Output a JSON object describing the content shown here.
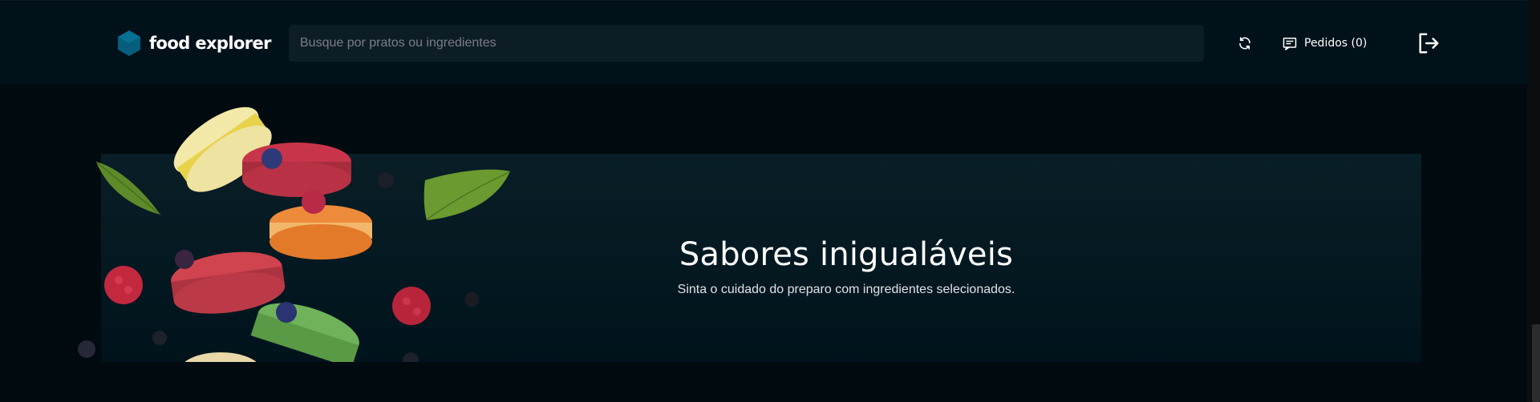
{
  "header": {
    "brand": "food explorer",
    "search": {
      "placeholder": "Busque por pratos ou ingredientes",
      "value": ""
    },
    "orders_label": "Pedidos (0)"
  },
  "icons": {
    "logo": "hexagon-logo-icon",
    "refresh": "refresh-icon",
    "orders": "receipt-icon",
    "logout": "sign-out-icon"
  },
  "banner": {
    "title": "Sabores inigualáveis",
    "subtitle": "Sinta o cuidado do preparo com ingredientes selecionados."
  },
  "colors": {
    "background": "#000A0F",
    "header_bg": "#00111A",
    "search_bg": "#0D1D25",
    "banner_bg": "#091E26",
    "logo_accent": "#065E7C"
  }
}
